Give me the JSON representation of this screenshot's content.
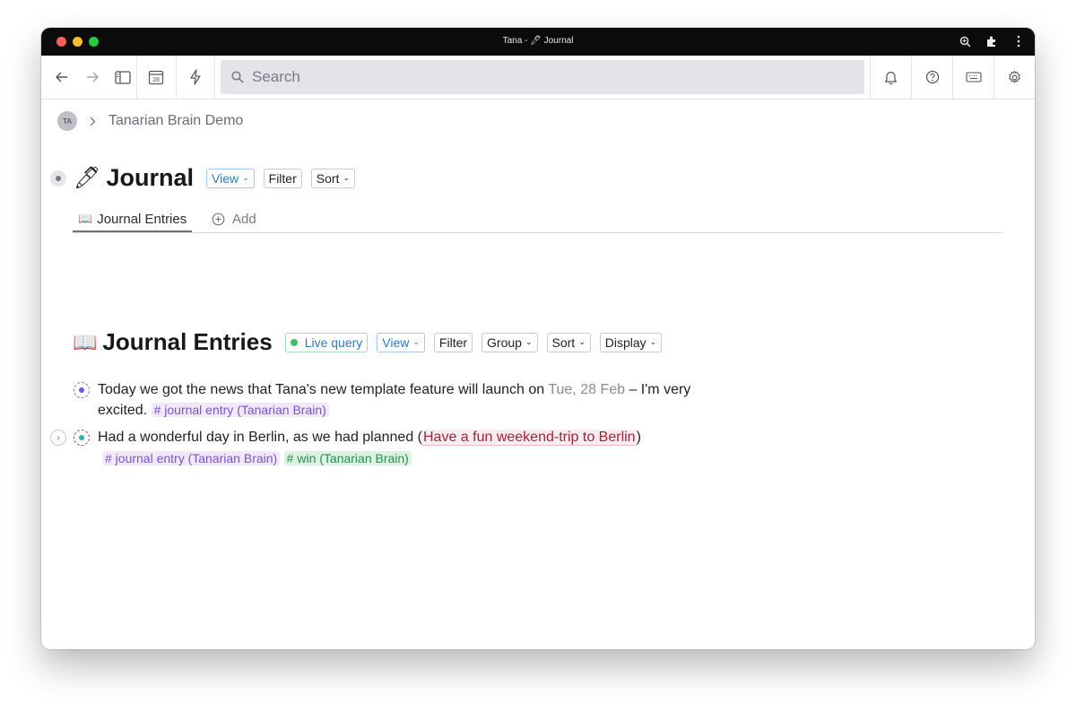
{
  "window": {
    "title": "Tana - 🖊 Journal"
  },
  "toolbar": {
    "search_placeholder": "Search",
    "calendar_day": "28"
  },
  "breadcrumb": {
    "avatar_initials": "TA",
    "workspace": "Tanarian Brain Demo"
  },
  "page": {
    "icon": "🖊",
    "title": "Journal",
    "view_label": "View",
    "filter_label": "Filter",
    "sort_label": "Sort"
  },
  "tabs": {
    "active": {
      "icon": "📖",
      "label": "Journal Entries"
    },
    "add_label": "Add"
  },
  "section": {
    "icon": "📖",
    "title": "Journal Entries",
    "live_query_label": "Live query",
    "view_label": "View",
    "filter_label": "Filter",
    "group_label": "Group",
    "sort_label": "Sort",
    "display_label": "Display"
  },
  "entries": [
    {
      "text_before": "Today we got the news that Tana's new template feature will launch on ",
      "date_ref": "Tue, 28 Feb",
      "text_after": " – I'm very",
      "text_line2": "excited.",
      "tags": [
        "# journal entry (Tanarian Brain)"
      ]
    },
    {
      "text_before": "Had a wonderful day in Berlin, as we had planned (",
      "node_ref": "Have a fun weekend-trip to Berlin",
      "text_after": ")",
      "tags": [
        "# journal entry (Tanarian Brain)",
        "# win (Tanarian Brain)"
      ]
    }
  ],
  "colors": {
    "accent_blue": "#2a7ac7",
    "tag_purple": "#7b55c9",
    "tag_green": "#2a8d4f",
    "ref_red": "#a0243a"
  }
}
